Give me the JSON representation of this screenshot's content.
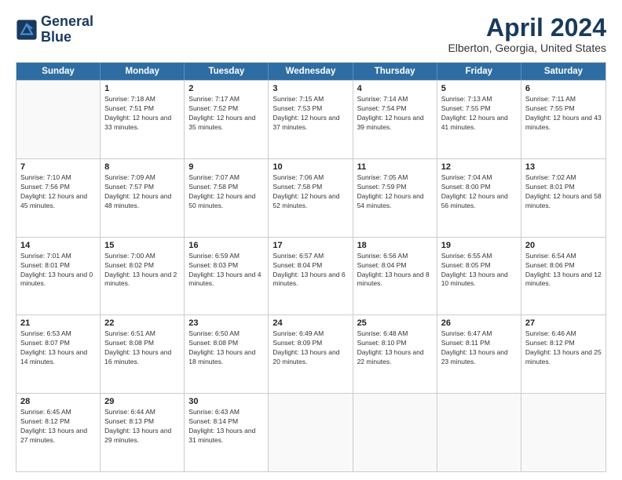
{
  "header": {
    "logo_line1": "General",
    "logo_line2": "Blue",
    "title": "April 2024",
    "subtitle": "Elberton, Georgia, United States"
  },
  "weekdays": [
    "Sunday",
    "Monday",
    "Tuesday",
    "Wednesday",
    "Thursday",
    "Friday",
    "Saturday"
  ],
  "weeks": [
    [
      {
        "day": "",
        "empty": true
      },
      {
        "day": "1",
        "sunrise": "7:18 AM",
        "sunset": "7:51 PM",
        "daylight": "12 hours and 33 minutes."
      },
      {
        "day": "2",
        "sunrise": "7:17 AM",
        "sunset": "7:52 PM",
        "daylight": "12 hours and 35 minutes."
      },
      {
        "day": "3",
        "sunrise": "7:15 AM",
        "sunset": "7:53 PM",
        "daylight": "12 hours and 37 minutes."
      },
      {
        "day": "4",
        "sunrise": "7:14 AM",
        "sunset": "7:54 PM",
        "daylight": "12 hours and 39 minutes."
      },
      {
        "day": "5",
        "sunrise": "7:13 AM",
        "sunset": "7:55 PM",
        "daylight": "12 hours and 41 minutes."
      },
      {
        "day": "6",
        "sunrise": "7:11 AM",
        "sunset": "7:55 PM",
        "daylight": "12 hours and 43 minutes."
      }
    ],
    [
      {
        "day": "7",
        "sunrise": "7:10 AM",
        "sunset": "7:56 PM",
        "daylight": "12 hours and 45 minutes."
      },
      {
        "day": "8",
        "sunrise": "7:09 AM",
        "sunset": "7:57 PM",
        "daylight": "12 hours and 48 minutes."
      },
      {
        "day": "9",
        "sunrise": "7:07 AM",
        "sunset": "7:58 PM",
        "daylight": "12 hours and 50 minutes."
      },
      {
        "day": "10",
        "sunrise": "7:06 AM",
        "sunset": "7:58 PM",
        "daylight": "12 hours and 52 minutes."
      },
      {
        "day": "11",
        "sunrise": "7:05 AM",
        "sunset": "7:59 PM",
        "daylight": "12 hours and 54 minutes."
      },
      {
        "day": "12",
        "sunrise": "7:04 AM",
        "sunset": "8:00 PM",
        "daylight": "12 hours and 56 minutes."
      },
      {
        "day": "13",
        "sunrise": "7:02 AM",
        "sunset": "8:01 PM",
        "daylight": "12 hours and 58 minutes."
      }
    ],
    [
      {
        "day": "14",
        "sunrise": "7:01 AM",
        "sunset": "8:01 PM",
        "daylight": "13 hours and 0 minutes."
      },
      {
        "day": "15",
        "sunrise": "7:00 AM",
        "sunset": "8:02 PM",
        "daylight": "13 hours and 2 minutes."
      },
      {
        "day": "16",
        "sunrise": "6:59 AM",
        "sunset": "8:03 PM",
        "daylight": "13 hours and 4 minutes."
      },
      {
        "day": "17",
        "sunrise": "6:57 AM",
        "sunset": "8:04 PM",
        "daylight": "13 hours and 6 minutes."
      },
      {
        "day": "18",
        "sunrise": "6:56 AM",
        "sunset": "8:04 PM",
        "daylight": "13 hours and 8 minutes."
      },
      {
        "day": "19",
        "sunrise": "6:55 AM",
        "sunset": "8:05 PM",
        "daylight": "13 hours and 10 minutes."
      },
      {
        "day": "20",
        "sunrise": "6:54 AM",
        "sunset": "8:06 PM",
        "daylight": "13 hours and 12 minutes."
      }
    ],
    [
      {
        "day": "21",
        "sunrise": "6:53 AM",
        "sunset": "8:07 PM",
        "daylight": "13 hours and 14 minutes."
      },
      {
        "day": "22",
        "sunrise": "6:51 AM",
        "sunset": "8:08 PM",
        "daylight": "13 hours and 16 minutes."
      },
      {
        "day": "23",
        "sunrise": "6:50 AM",
        "sunset": "8:08 PM",
        "daylight": "13 hours and 18 minutes."
      },
      {
        "day": "24",
        "sunrise": "6:49 AM",
        "sunset": "8:09 PM",
        "daylight": "13 hours and 20 minutes."
      },
      {
        "day": "25",
        "sunrise": "6:48 AM",
        "sunset": "8:10 PM",
        "daylight": "13 hours and 22 minutes."
      },
      {
        "day": "26",
        "sunrise": "6:47 AM",
        "sunset": "8:11 PM",
        "daylight": "13 hours and 23 minutes."
      },
      {
        "day": "27",
        "sunrise": "6:46 AM",
        "sunset": "8:12 PM",
        "daylight": "13 hours and 25 minutes."
      }
    ],
    [
      {
        "day": "28",
        "sunrise": "6:45 AM",
        "sunset": "8:12 PM",
        "daylight": "13 hours and 27 minutes."
      },
      {
        "day": "29",
        "sunrise": "6:44 AM",
        "sunset": "8:13 PM",
        "daylight": "13 hours and 29 minutes."
      },
      {
        "day": "30",
        "sunrise": "6:43 AM",
        "sunset": "8:14 PM",
        "daylight": "13 hours and 31 minutes."
      },
      {
        "day": "",
        "empty": true
      },
      {
        "day": "",
        "empty": true
      },
      {
        "day": "",
        "empty": true
      },
      {
        "day": "",
        "empty": true
      }
    ]
  ]
}
